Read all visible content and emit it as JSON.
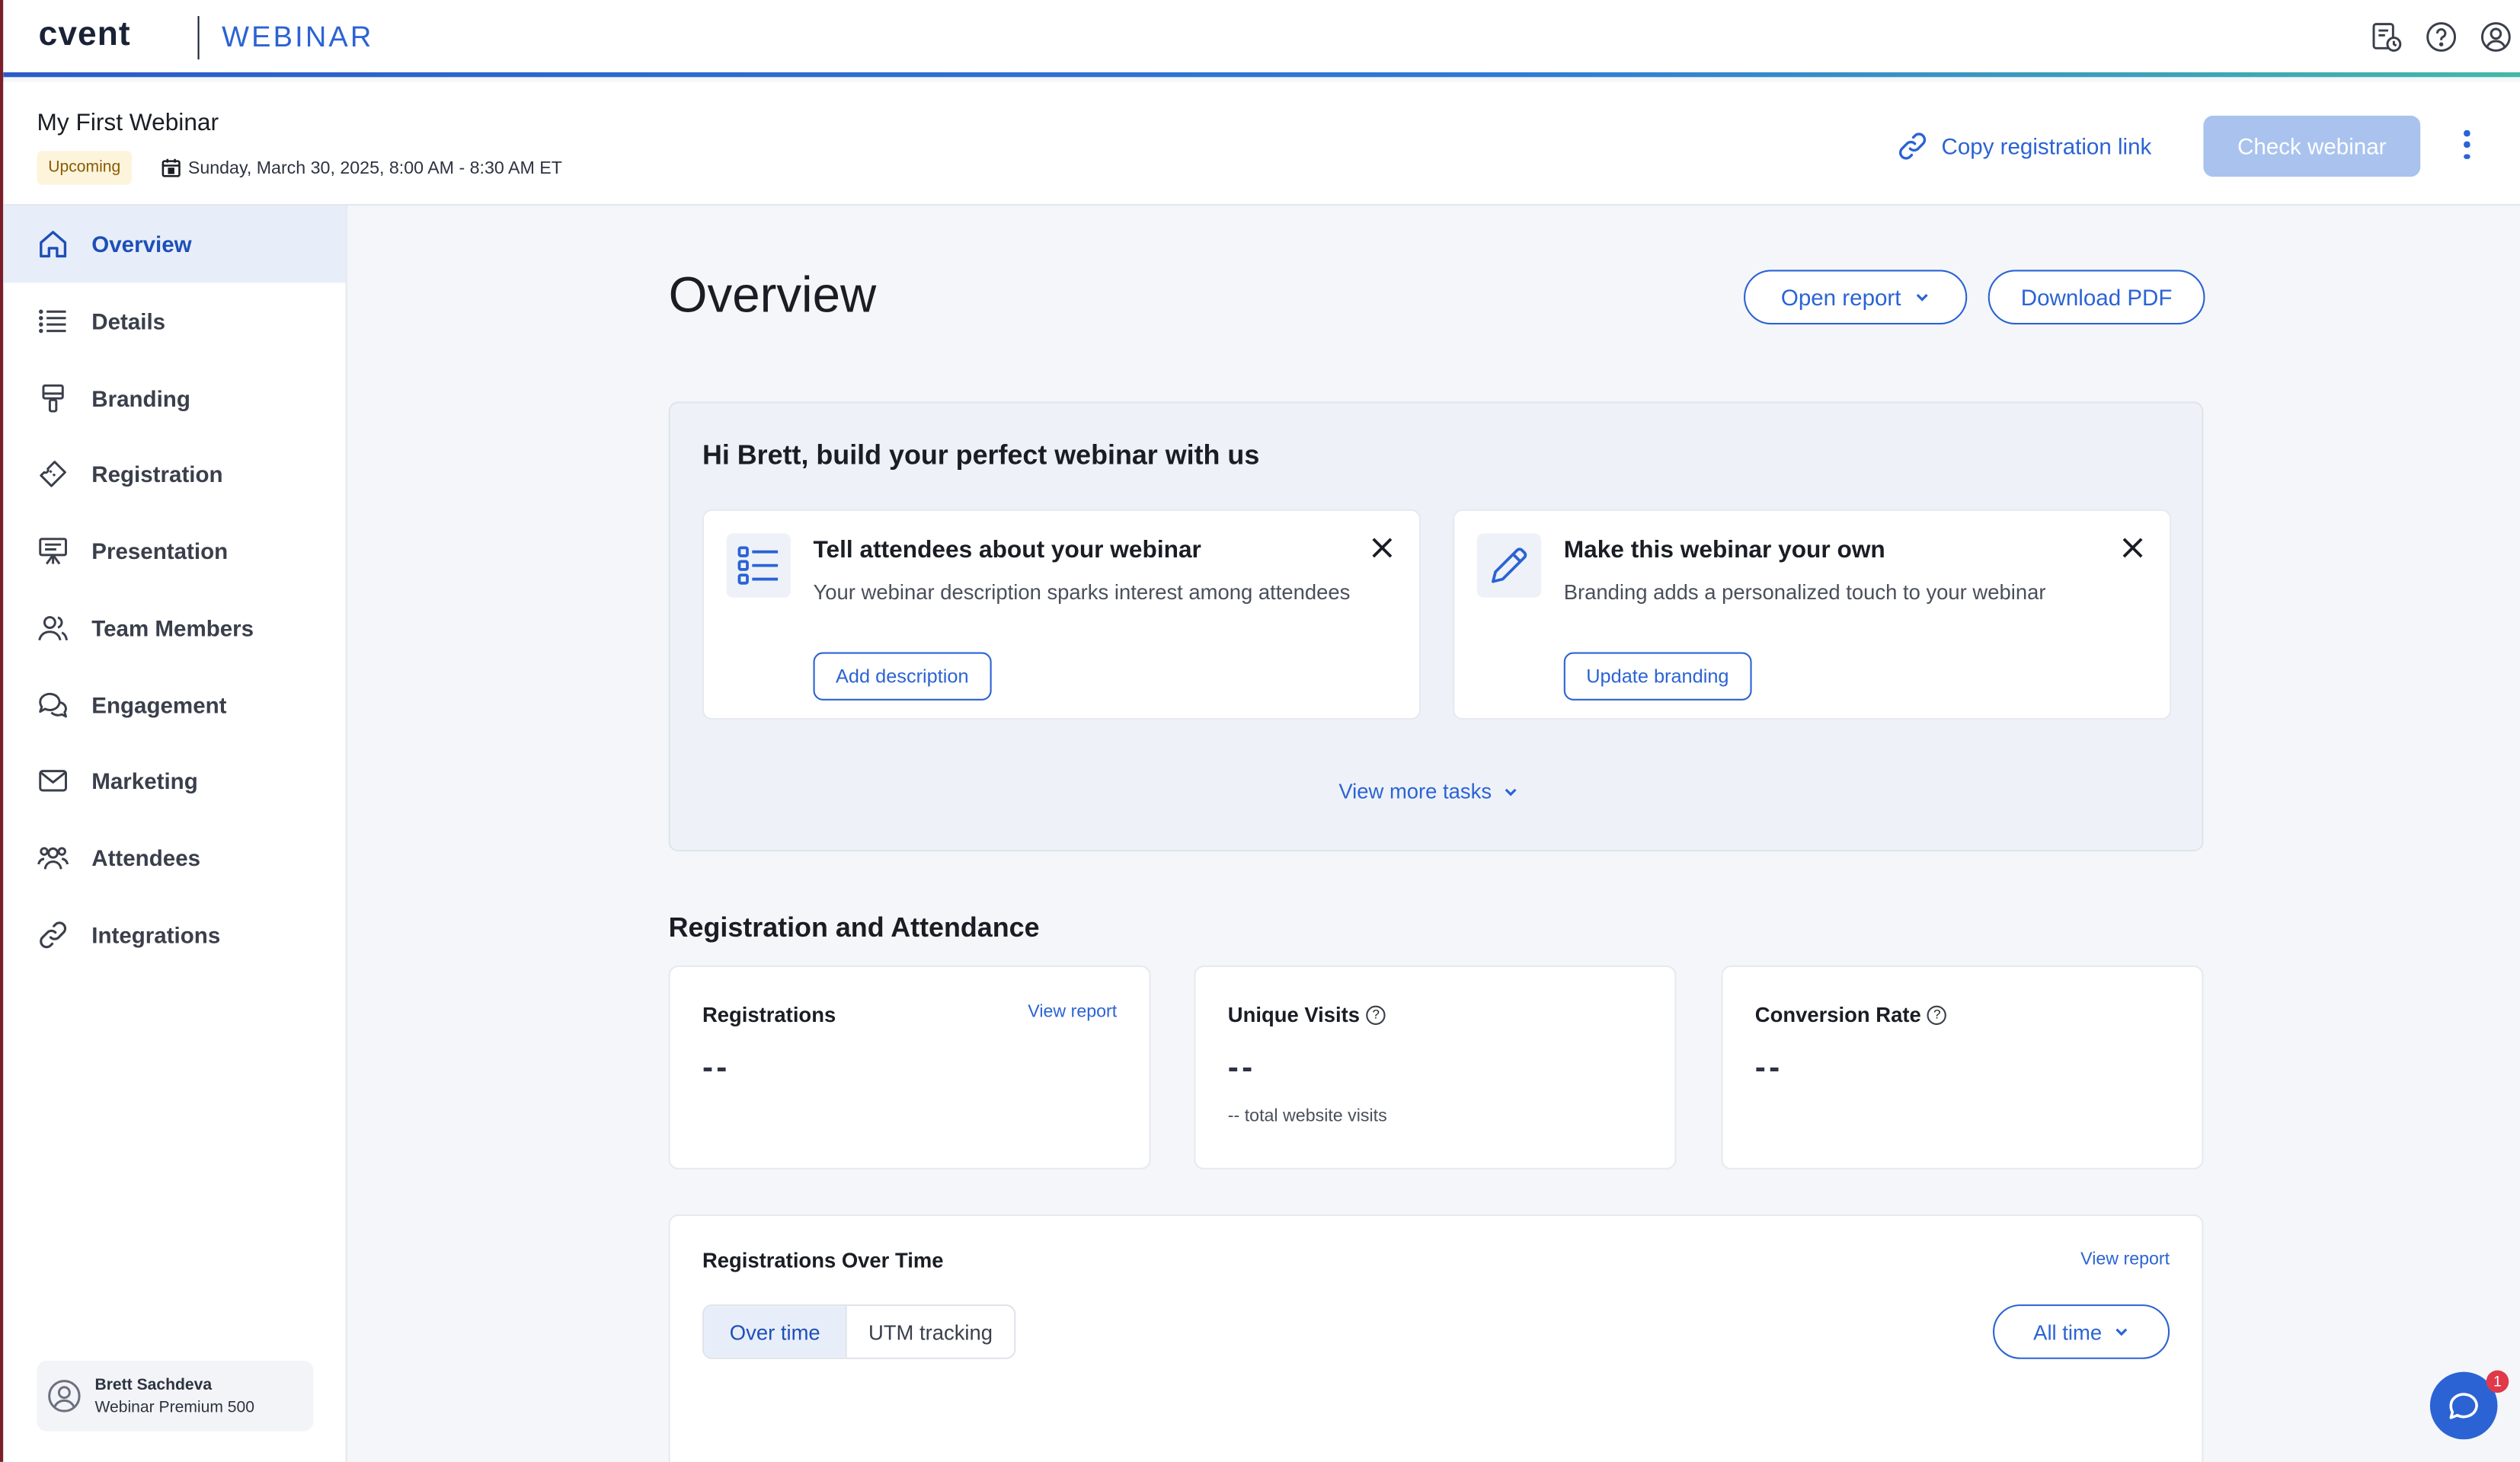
{
  "brand": {
    "logo": "cvent",
    "product": "WEBINAR"
  },
  "topbar": {
    "icons": [
      "calendar-clock-icon",
      "help-icon",
      "account-icon"
    ]
  },
  "event": {
    "title": "My First Webinar",
    "status": "Upcoming",
    "date": "Sunday, March 30, 2025, 8:00 AM - 8:30 AM ET",
    "copy_link_label": "Copy registration link",
    "check_button": "Check webinar"
  },
  "sidebar": {
    "items": [
      {
        "label": "Overview",
        "icon": "home-icon",
        "active": true
      },
      {
        "label": "Details",
        "icon": "list-icon"
      },
      {
        "label": "Branding",
        "icon": "paint-roller-icon"
      },
      {
        "label": "Registration",
        "icon": "ticket-icon"
      },
      {
        "label": "Presentation",
        "icon": "presentation-icon"
      },
      {
        "label": "Team Members",
        "icon": "people-icon"
      },
      {
        "label": "Engagement",
        "icon": "chat-bubbles-icon"
      },
      {
        "label": "Marketing",
        "icon": "mail-icon"
      },
      {
        "label": "Attendees",
        "icon": "group-icon"
      },
      {
        "label": "Integrations",
        "icon": "link-icon"
      }
    ],
    "user": {
      "name": "Brett Sachdeva",
      "plan": "Webinar Premium 500"
    }
  },
  "main": {
    "title": "Overview",
    "open_report": "Open report",
    "download_pdf": "Download PDF",
    "onboarding": {
      "heading": "Hi Brett, build your perfect webinar with us",
      "tasks": [
        {
          "title": "Tell attendees about your webinar",
          "description": "Your webinar description sparks interest among attendees",
          "button": "Add description",
          "icon": "list-icon"
        },
        {
          "title": "Make this webinar your own",
          "description": "Branding adds a personalized touch to your webinar",
          "button": "Update branding",
          "icon": "pencil-icon"
        }
      ],
      "view_more": "View more tasks"
    },
    "registration_attendance": {
      "title": "Registration and Attendance",
      "cards": [
        {
          "label": "Registrations",
          "value": "--",
          "link": "View report"
        },
        {
          "label": "Unique Visits",
          "value": "--",
          "sub": "-- total website visits"
        },
        {
          "label": "Conversion Rate",
          "value": "--"
        }
      ]
    },
    "registrations_over_time": {
      "title": "Registrations Over Time",
      "link": "View report",
      "tabs": [
        "Over time",
        "UTM tracking"
      ],
      "range": "All time"
    }
  },
  "chat": {
    "badge": "1"
  },
  "colors": {
    "accent": "#2b63d4",
    "active_bg": "#e8eef9",
    "badge_bg": "#fdf4dc"
  }
}
